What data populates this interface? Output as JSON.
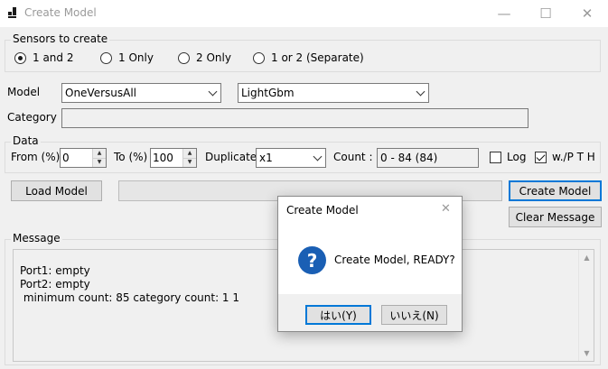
{
  "window": {
    "title": "Create Model",
    "minimize_glyph": "—",
    "maximize_glyph": "☐",
    "close_glyph": "✕"
  },
  "sensors": {
    "group_label": "Sensors to create",
    "options": [
      {
        "label": "1 and 2",
        "checked": true
      },
      {
        "label": "1 Only",
        "checked": false
      },
      {
        "label": "2 Only",
        "checked": false
      },
      {
        "label": "1 or 2 (Separate)",
        "checked": false
      }
    ]
  },
  "model": {
    "label": "Model",
    "type_value": "OneVersusAll",
    "algorithm_value": "LightGbm"
  },
  "category": {
    "label": "Category",
    "value": ""
  },
  "data": {
    "group_label": "Data",
    "from_label": "From (%)",
    "from_value": "0",
    "to_label": "To (%)",
    "to_value": "100",
    "duplicate_label": "Duplicate",
    "duplicate_value": "x1",
    "count_label": "Count :",
    "count_value": "0 - 84 (84)",
    "log_label": "Log",
    "log_checked": false,
    "wpth_label": "w./P T H",
    "wpth_checked": true
  },
  "actions": {
    "load_model": "Load Model",
    "create_model": "Create Model",
    "clear_message": "Clear Message"
  },
  "message": {
    "group_label": "Message",
    "lines": "Port1: empty\nPort2: empty\n minimum count: 85 category count: 1 1"
  },
  "dialog": {
    "title": "Create Model",
    "icon_glyph": "?",
    "text": "Create Model, READY?",
    "yes_label": "はい(Y)",
    "no_label": "いいえ(N)",
    "close_glyph": "✕"
  }
}
